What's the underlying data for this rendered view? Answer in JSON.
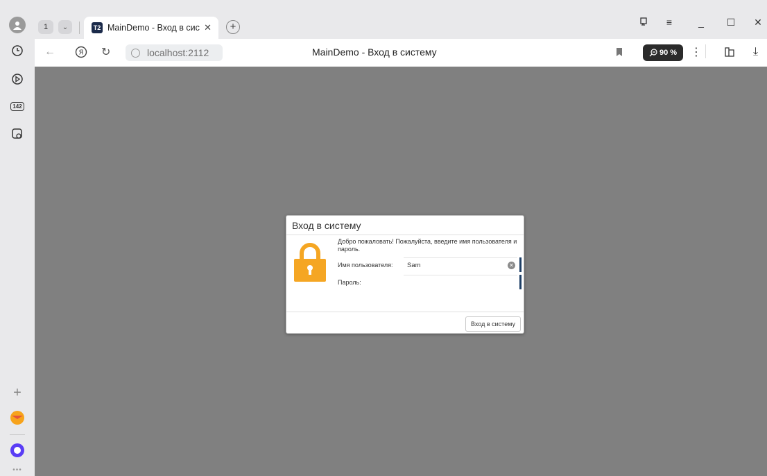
{
  "browser": {
    "tab_count": "1",
    "tab": {
      "title": "MainDemo - Вход в сис",
      "favicon": "T2"
    },
    "address": {
      "host": "localhost:2112",
      "page_title": "MainDemo - Вход в систему"
    },
    "zoom": "90 %"
  },
  "sidebar": {
    "icons": [
      "avatar-icon",
      "history-icon",
      "play-icon",
      "counter-142-icon",
      "screenshot-icon",
      "add-icon",
      "mail-icon",
      "alice-icon"
    ],
    "counter_label": "142"
  },
  "dialog": {
    "title": "Вход в систему",
    "welcome": "Добро пожаловать! Пожалуйста, введите имя пользователя и пароль.",
    "username_label": "Имя пользователя:",
    "username_value": "Sam",
    "password_label": "Пароль:",
    "password_value": "",
    "login_button": "Вход в систему"
  },
  "colors": {
    "lock": "#f5a623",
    "viewport": "#808080",
    "field_accent": "#1e3f66"
  }
}
